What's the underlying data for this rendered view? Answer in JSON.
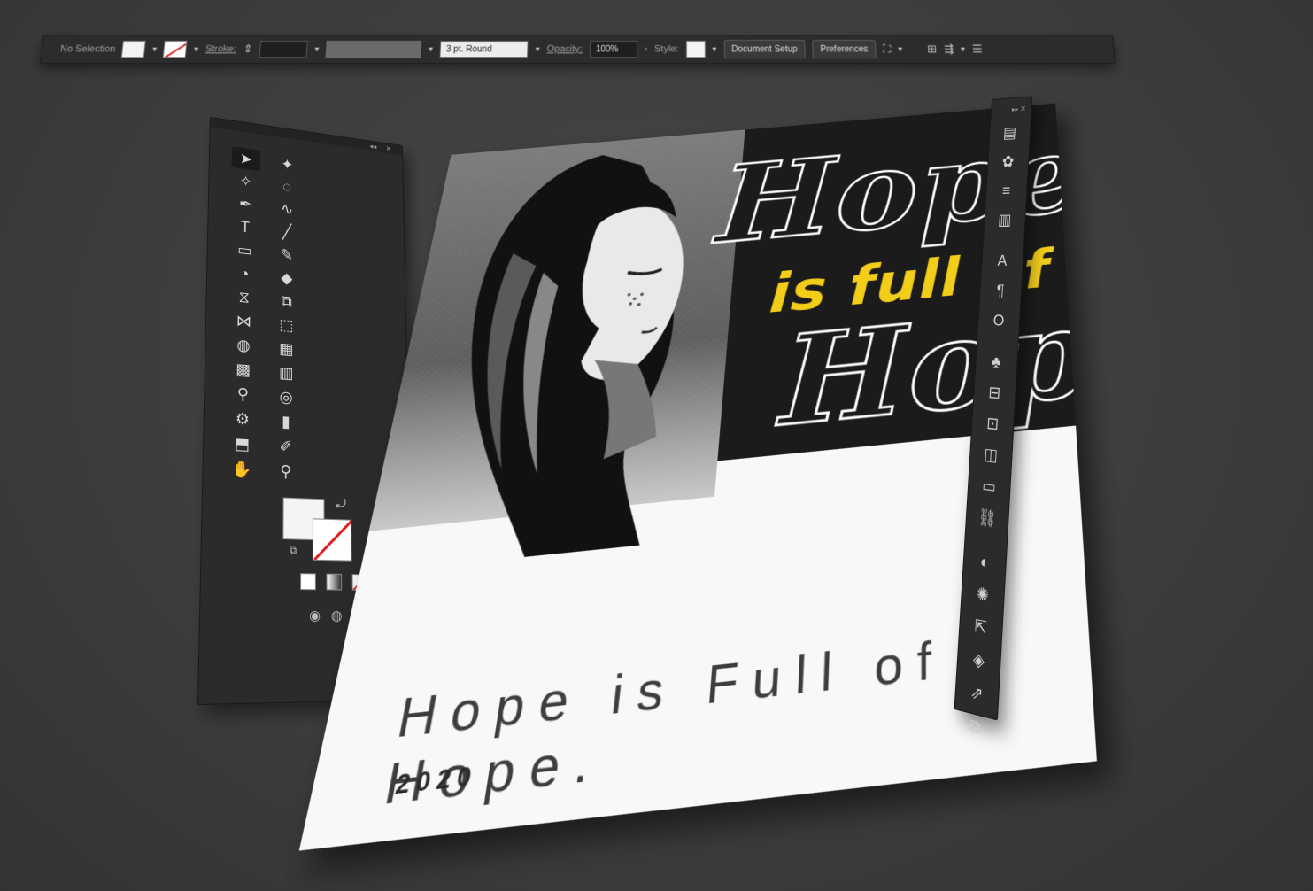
{
  "control_bar": {
    "selection_label": "No Selection",
    "stroke_label": "Stroke:",
    "brush_value": "3 pt. Round",
    "opacity_label": "Opacity:",
    "opacity_value": "100%",
    "style_label": "Style:",
    "document_setup_label": "Document Setup",
    "preferences_label": "Preferences"
  },
  "artboard": {
    "title_top": "Hope",
    "title_middle": "is full of",
    "title_bottom": "Hope",
    "tagline": "Hope is Full of Hope.",
    "year": "2020"
  },
  "colors": {
    "accent_yellow": "#f2cd1a",
    "artboard_dark": "#1b1b1b",
    "ui_panel": "#2b2b2b",
    "none_red": "#e02020"
  },
  "tools": [
    {
      "name": "selection-tool-icon",
      "glyph": "➤"
    },
    {
      "name": "direct-selection-tool-icon",
      "glyph": "✦"
    },
    {
      "name": "magic-wand-tool-icon",
      "glyph": "✧"
    },
    {
      "name": "lasso-tool-icon",
      "glyph": "◌"
    },
    {
      "name": "pen-tool-icon",
      "glyph": "✒"
    },
    {
      "name": "curvature-tool-icon",
      "glyph": "∿"
    },
    {
      "name": "type-tool-icon",
      "glyph": "T"
    },
    {
      "name": "line-segment-tool-icon",
      "glyph": "╱"
    },
    {
      "name": "rectangle-tool-icon",
      "glyph": "▭"
    },
    {
      "name": "paintbrush-tool-icon",
      "glyph": "✎"
    },
    {
      "name": "shaper-tool-icon",
      "glyph": "◔"
    },
    {
      "name": "eraser-tool-icon",
      "glyph": "◆"
    },
    {
      "name": "reflect-tool-icon",
      "glyph": "⧖"
    },
    {
      "name": "scale-tool-icon",
      "glyph": "⧉"
    },
    {
      "name": "width-tool-icon",
      "glyph": "⋈"
    },
    {
      "name": "free-transform-tool-icon",
      "glyph": "⬚"
    },
    {
      "name": "shape-builder-tool-icon",
      "glyph": "◍"
    },
    {
      "name": "perspective-grid-tool-icon",
      "glyph": "▦"
    },
    {
      "name": "mesh-tool-icon",
      "glyph": "▩"
    },
    {
      "name": "gradient-tool-icon",
      "glyph": "▥"
    },
    {
      "name": "eyedropper-tool-icon",
      "glyph": "⚲"
    },
    {
      "name": "blend-tool-icon",
      "glyph": "◎"
    },
    {
      "name": "symbol-sprayer-tool-icon",
      "glyph": "⚙"
    },
    {
      "name": "column-graph-tool-icon",
      "glyph": "▮"
    },
    {
      "name": "artboard-tool-icon",
      "glyph": "⬒"
    },
    {
      "name": "slice-tool-icon",
      "glyph": "✐"
    },
    {
      "name": "hand-tool-icon",
      "glyph": "✋"
    },
    {
      "name": "zoom-tool-icon",
      "glyph": "⚲"
    }
  ],
  "dock_icons": [
    "properties-icon",
    "color-icon",
    "stroke-icon",
    "gradient-icon",
    "character-icon",
    "paragraph-icon",
    "opentype-icon",
    "symbols-icon",
    "align-icon",
    "transform-icon",
    "pathfinder-icon",
    "artboards-icon",
    "links-icon",
    "appearance-icon",
    "graphic-styles-icon",
    "asset-export-icon",
    "layers-icon",
    "export-icon",
    "libraries-icon"
  ]
}
